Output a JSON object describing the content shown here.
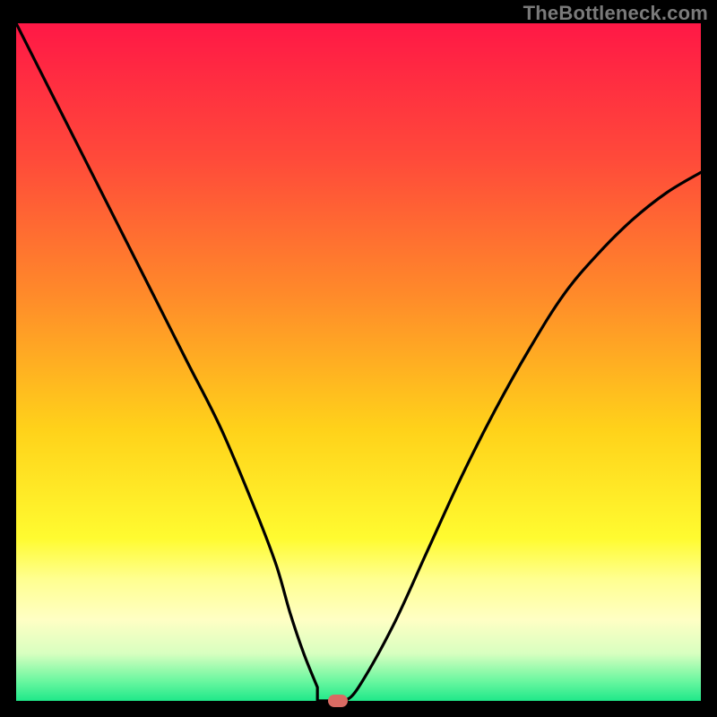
{
  "watermark": "TheBottleneck.com",
  "chart_data": {
    "type": "line",
    "title": "",
    "xlabel": "",
    "ylabel": "",
    "xlim": [
      0,
      100
    ],
    "ylim": [
      0,
      100
    ],
    "x": [
      0,
      5,
      10,
      15,
      20,
      25,
      30,
      35,
      38,
      40,
      42,
      44,
      46,
      48,
      50,
      55,
      60,
      65,
      70,
      75,
      80,
      85,
      90,
      95,
      100
    ],
    "values": [
      100,
      90,
      80,
      70,
      60,
      50,
      40,
      28,
      20,
      13,
      7,
      2,
      0,
      0,
      2,
      11,
      22,
      33,
      43,
      52,
      60,
      66,
      71,
      75,
      78
    ],
    "notch_x_range": [
      44,
      48
    ],
    "marker": {
      "x": 47,
      "y": 0
    },
    "gradient_stops": [
      {
        "offset": 0.0,
        "color": "#ff1846"
      },
      {
        "offset": 0.2,
        "color": "#ff4a3a"
      },
      {
        "offset": 0.4,
        "color": "#ff8a2a"
      },
      {
        "offset": 0.6,
        "color": "#ffd21a"
      },
      {
        "offset": 0.76,
        "color": "#fffb30"
      },
      {
        "offset": 0.82,
        "color": "#ffff90"
      },
      {
        "offset": 0.88,
        "color": "#ffffc4"
      },
      {
        "offset": 0.93,
        "color": "#d8ffc0"
      },
      {
        "offset": 0.97,
        "color": "#6cf7a0"
      },
      {
        "offset": 1.0,
        "color": "#1fe88a"
      }
    ]
  }
}
